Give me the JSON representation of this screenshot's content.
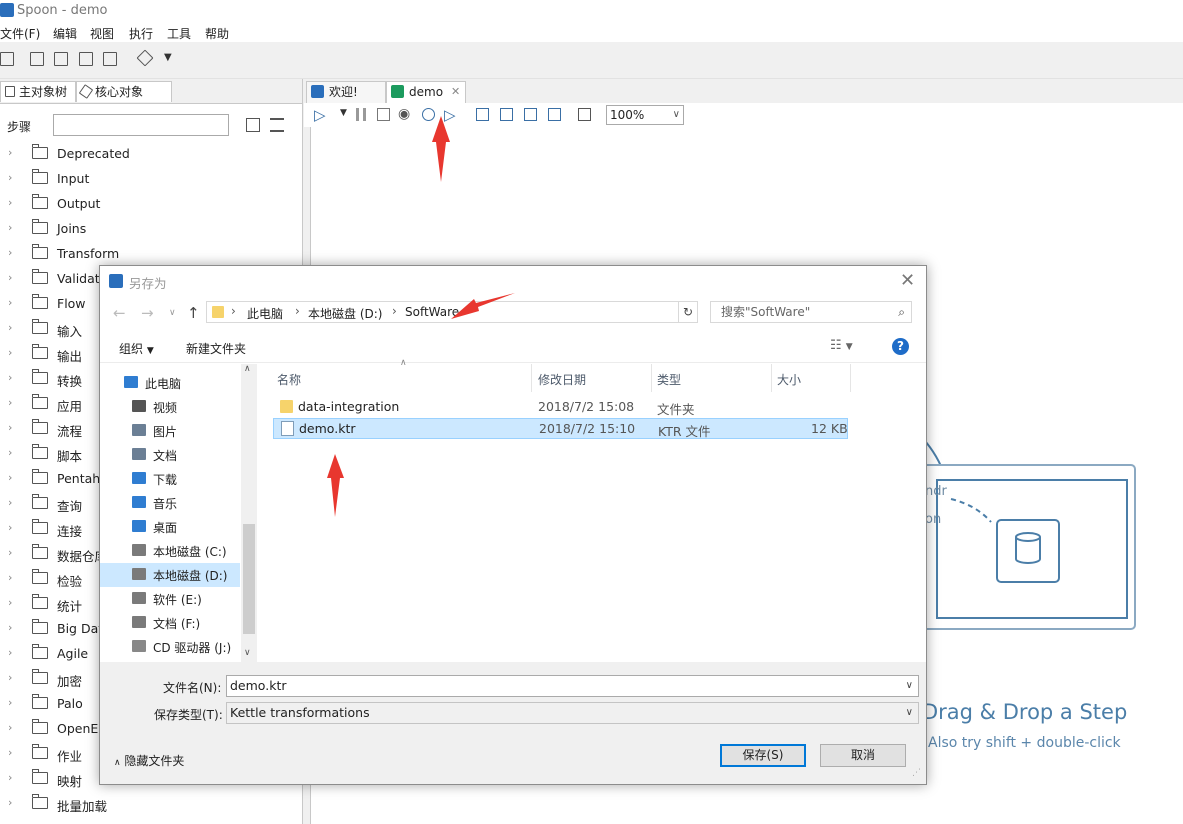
{
  "window": {
    "title": "Spoon - demo"
  },
  "menu": [
    "文件(F)",
    "编辑",
    "视图",
    "执行",
    "工具",
    "帮助"
  ],
  "left_panel": {
    "tabs": [
      "主对象树",
      "核心对象"
    ],
    "steps_label": "步骤",
    "search_value": "",
    "categories": [
      "Deprecated",
      "Input",
      "Output",
      "Joins",
      "Transform",
      "Validati",
      "Flow",
      "输入",
      "输出",
      "转换",
      "应用",
      "流程",
      "脚本",
      "Pentaho",
      "查询",
      "连接",
      "数据仓库",
      "检验",
      "统计",
      "Big Dat",
      "Agile",
      "加密",
      "Palo",
      "OpenEF",
      "作业",
      "映射",
      "批量加载"
    ]
  },
  "editor": {
    "tabs": [
      {
        "label": "欢迎!"
      },
      {
        "label": "demo"
      }
    ],
    "zoom": "100%",
    "canvas_hint_title": "Drag & Drop a Step",
    "canvas_hint_sub": "Also try shift + double-click",
    "canvas_partial_1": "ndr",
    "canvas_partial_2": "on"
  },
  "dialog": {
    "title": "另存为",
    "breadcrumb": [
      "此电脑",
      "本地磁盘 (D:)",
      "SoftWare"
    ],
    "search_placeholder": "搜索\"SoftWare\"",
    "organize": "组织",
    "new_folder": "新建文件夹",
    "nav_items": [
      {
        "label": "此电脑",
        "icon": "computer-icon"
      },
      {
        "label": "视频",
        "icon": "video-icon"
      },
      {
        "label": "图片",
        "icon": "picture-icon"
      },
      {
        "label": "文档",
        "icon": "document-icon"
      },
      {
        "label": "下载",
        "icon": "download-icon"
      },
      {
        "label": "音乐",
        "icon": "music-icon"
      },
      {
        "label": "桌面",
        "icon": "desktop-icon"
      },
      {
        "label": "本地磁盘 (C:)",
        "icon": "drive-icon"
      },
      {
        "label": "本地磁盘 (D:)",
        "icon": "drive-icon",
        "selected": true
      },
      {
        "label": "软件 (E:)",
        "icon": "drive-icon"
      },
      {
        "label": "文档 (F:)",
        "icon": "drive-icon"
      },
      {
        "label": "CD 驱动器 (J:)",
        "icon": "cd-drive-icon"
      }
    ],
    "columns": [
      "名称",
      "修改日期",
      "类型",
      "大小"
    ],
    "files": [
      {
        "name": "data-integration",
        "date": "2018/7/2 15:08",
        "type": "文件夹",
        "size": "",
        "icon": "folder-icon"
      },
      {
        "name": "demo.ktr",
        "date": "2018/7/2 15:10",
        "type": "KTR 文件",
        "size": "12 KB",
        "icon": "file-icon",
        "selected": true
      }
    ],
    "filename_label": "文件名(N):",
    "filename_value": "demo.ktr",
    "filetype_label": "保存类型(T):",
    "filetype_value": "Kettle transformations",
    "hide_folders": "隐藏文件夹",
    "save_button": "保存(S)",
    "cancel_button": "取消"
  },
  "colors": {
    "accent": "#0078d7",
    "selection": "#cce8ff",
    "annotation_arrow": "#e8372f",
    "hint_text": "#4b7ea8"
  }
}
